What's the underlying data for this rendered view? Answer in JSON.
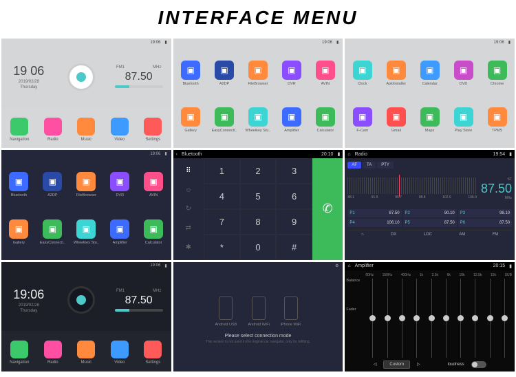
{
  "title": "INTERFACE MENU",
  "status": {
    "time_a": "19:06",
    "time_b": "20:10",
    "time_c": "19:54",
    "time_d": "20:15"
  },
  "home": {
    "clock": "19 06",
    "date": "2019/02/28",
    "day": "Thursday",
    "band": "FM1",
    "freq": "87.50",
    "unit": "MHz",
    "items": [
      {
        "label": "Navigation",
        "color": "#3bc96b"
      },
      {
        "label": "Radio",
        "color": "#ff4fa3"
      },
      {
        "label": "Music",
        "color": "#ff8a3d"
      },
      {
        "label": "Video",
        "color": "#3d9bff"
      },
      {
        "label": "Settings",
        "color": "#ff5a5a"
      }
    ]
  },
  "apps_light_1": [
    {
      "label": "Bluetooth",
      "color": "#3d6bff"
    },
    {
      "label": "A2DP",
      "color": "#2a4aa8"
    },
    {
      "label": "FileBrowser",
      "color": "#ff8a3d"
    },
    {
      "label": "DVR",
      "color": "#8a4dff"
    },
    {
      "label": "AVIN",
      "color": "#ff4f8a"
    },
    {
      "label": "Gallery",
      "color": "#ff8a3d"
    },
    {
      "label": "EasyConnecti..",
      "color": "#3dbb5a"
    },
    {
      "label": "Wheelkey Stu..",
      "color": "#3dd4d4"
    },
    {
      "label": "Amplifier",
      "color": "#3d6bff"
    },
    {
      "label": "Calculator",
      "color": "#3dbb5a"
    }
  ],
  "apps_light_2": [
    {
      "label": "Clock",
      "color": "#3dd4d4"
    },
    {
      "label": "ApkInstaller",
      "color": "#ff8a3d"
    },
    {
      "label": "Calendar",
      "color": "#3d9bff"
    },
    {
      "label": "DVD",
      "color": "#c94dc9"
    },
    {
      "label": "Chrome",
      "color": "#3dbb5a"
    },
    {
      "label": "F-Cam",
      "color": "#8a4dff"
    },
    {
      "label": "Gmail",
      "color": "#ff4f4f"
    },
    {
      "label": "Maps",
      "color": "#3dbb5a"
    },
    {
      "label": "Play Store",
      "color": "#3dd4d4"
    },
    {
      "label": "TPMS",
      "color": "#ff8a3d"
    }
  ],
  "apps_dark": [
    {
      "label": "Bluetooth",
      "color": "#3d6bff"
    },
    {
      "label": "A2DP",
      "color": "#2a4aa8"
    },
    {
      "label": "FileBrowser",
      "color": "#ff8a3d"
    },
    {
      "label": "DVR",
      "color": "#8a4dff"
    },
    {
      "label": "AVIN",
      "color": "#ff4f8a"
    },
    {
      "label": "Gallery",
      "color": "#ff8a3d"
    },
    {
      "label": "EasyConnecti..",
      "color": "#3dbb5a"
    },
    {
      "label": "Wheelkey Stu..",
      "color": "#3dd4d4"
    },
    {
      "label": "Amplifier",
      "color": "#3d6bff"
    },
    {
      "label": "Calculator",
      "color": "#3dbb5a"
    }
  ],
  "phone": {
    "title": "Bluetooth",
    "keys": [
      "1",
      "2",
      "3",
      "4",
      "5",
      "6",
      "7",
      "8",
      "9",
      "*",
      "0",
      "#"
    ]
  },
  "radio": {
    "title": "Radio",
    "tabs": [
      "AF",
      "TA",
      "PTY"
    ],
    "active_tab": 0,
    "freq": "87.50",
    "unit": "MHz",
    "ticks": [
      "88.1",
      "91.5",
      "95.7",
      "98.8",
      "102.6",
      "106.0"
    ],
    "presets": [
      {
        "n": "P1",
        "v": "87.50"
      },
      {
        "n": "P2",
        "v": "90.10"
      },
      {
        "n": "P3",
        "v": "98.10"
      },
      {
        "n": "P4",
        "v": "106.10"
      },
      {
        "n": "P5",
        "v": "87.50"
      },
      {
        "n": "P6",
        "v": "87.50"
      }
    ],
    "bands": [
      "DX",
      "LOC",
      "AM",
      "FM"
    ],
    "home_icon": "⌂"
  },
  "home_dark": {
    "clock": "19:06",
    "date": "2019/02/28",
    "day": "Thursday",
    "band": "FM1",
    "freq": "87.50",
    "unit": "MHz"
  },
  "connect": {
    "options": [
      "Android USB",
      "Android WiFi",
      "iPhone WiFi"
    ],
    "msg": "Please select connection mode",
    "sub": "This version is not used in the original car navigator, only for refitting."
  },
  "amp": {
    "title": "Amplifier",
    "bands": [
      "60Hz",
      "150Hz",
      "400Hz",
      "1k",
      "2.5k",
      "6k",
      "10k",
      "12.5k",
      "15k",
      "SUB"
    ],
    "values": [
      0,
      0,
      0,
      0,
      0,
      0,
      0,
      0,
      0,
      0
    ],
    "side1": "Balance",
    "side2": "Fader",
    "preset": "Custom",
    "loudness": "loudness"
  }
}
